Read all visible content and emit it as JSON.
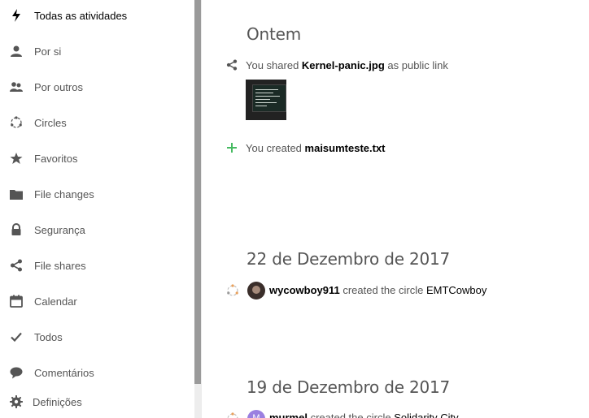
{
  "sidebar": {
    "items": [
      {
        "label": "Todas as atividades",
        "icon": "lightning-icon"
      },
      {
        "label": "Por si",
        "icon": "person-icon"
      },
      {
        "label": "Por outros",
        "icon": "group-icon"
      },
      {
        "label": "Circles",
        "icon": "circles-icon"
      },
      {
        "label": "Favoritos",
        "icon": "star-icon"
      },
      {
        "label": "File changes",
        "icon": "folder-icon"
      },
      {
        "label": "Segurança",
        "icon": "lock-icon"
      },
      {
        "label": "File shares",
        "icon": "share-icon"
      },
      {
        "label": "Calendar",
        "icon": "calendar-icon"
      },
      {
        "label": "Todos",
        "icon": "checkmark-icon"
      },
      {
        "label": "Comentários",
        "icon": "comment-icon"
      }
    ],
    "settings_label": "Definições"
  },
  "stream": {
    "groups": [
      {
        "day": "Ontem",
        "entries": [
          {
            "prefix": "You shared ",
            "object": "Kernel-panic.jpg",
            "suffix": " as public link",
            "icon": "share-icon"
          },
          {
            "prefix": "You created ",
            "object": "maisumteste.txt",
            "suffix": "",
            "icon": "plus-icon"
          }
        ]
      },
      {
        "day": "22 de Dezembro de 2017",
        "entries": [
          {
            "user": "wycowboy911",
            "prefix": " created the circle ",
            "object": "EMTCowboy",
            "icon": "circles-icon"
          }
        ]
      },
      {
        "day": "19 de Dezembro de 2017",
        "entries": [
          {
            "user": "murmel",
            "prefix": " created the circle ",
            "object": "Solidarity City",
            "icon": "circles-icon",
            "avatar_letter": "M"
          }
        ]
      }
    ]
  },
  "colors": {
    "accent_plus": "#46ba61",
    "circle_orange": "#e9a05b",
    "avatar_purple": "#9b7fe0"
  }
}
